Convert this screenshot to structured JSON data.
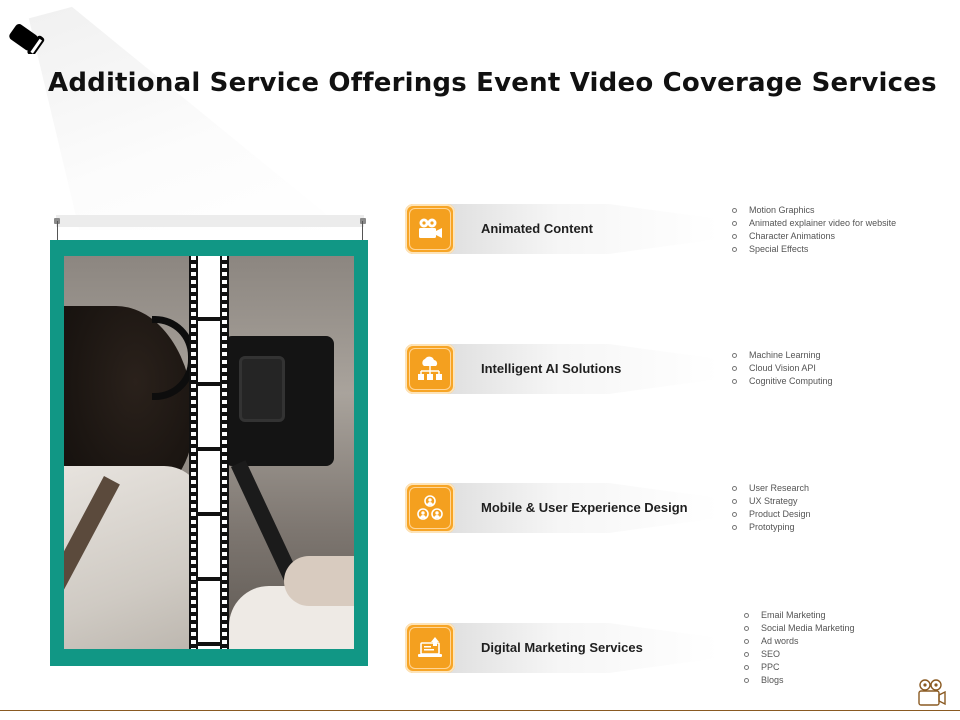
{
  "title": "Additional Service Offerings Event Video Coverage Services",
  "colors": {
    "accent": "#f7a526",
    "frame": "#119785",
    "text": "#1a1a1a",
    "line": "#8a5a22"
  },
  "services": [
    {
      "label": "Animated Content",
      "icon": "video-camera-icon",
      "bullets": [
        "Motion Graphics",
        "Animated explainer video for website",
        "Character Animations",
        "Special Effects"
      ]
    },
    {
      "label": "Intelligent AI Solutions",
      "icon": "cloud-network-icon",
      "bullets": [
        "Machine Learning",
        "Cloud Vision API",
        "Cognitive Computing"
      ]
    },
    {
      "label": "Mobile & User Experience Design",
      "icon": "user-group-icon",
      "bullets": [
        "User Research",
        "UX Strategy",
        "Product Design",
        "Prototyping"
      ]
    },
    {
      "label": "Digital Marketing Services",
      "icon": "laptop-marketing-icon",
      "bullets": [
        "Email Marketing",
        "Social Media Marketing",
        "Ad words",
        "SEO",
        "PPC",
        "Blogs"
      ]
    }
  ],
  "decor": {
    "spotlight": "spotlight-icon",
    "corner_logo": "film-camera-icon",
    "picture": "cameraman-photo"
  }
}
